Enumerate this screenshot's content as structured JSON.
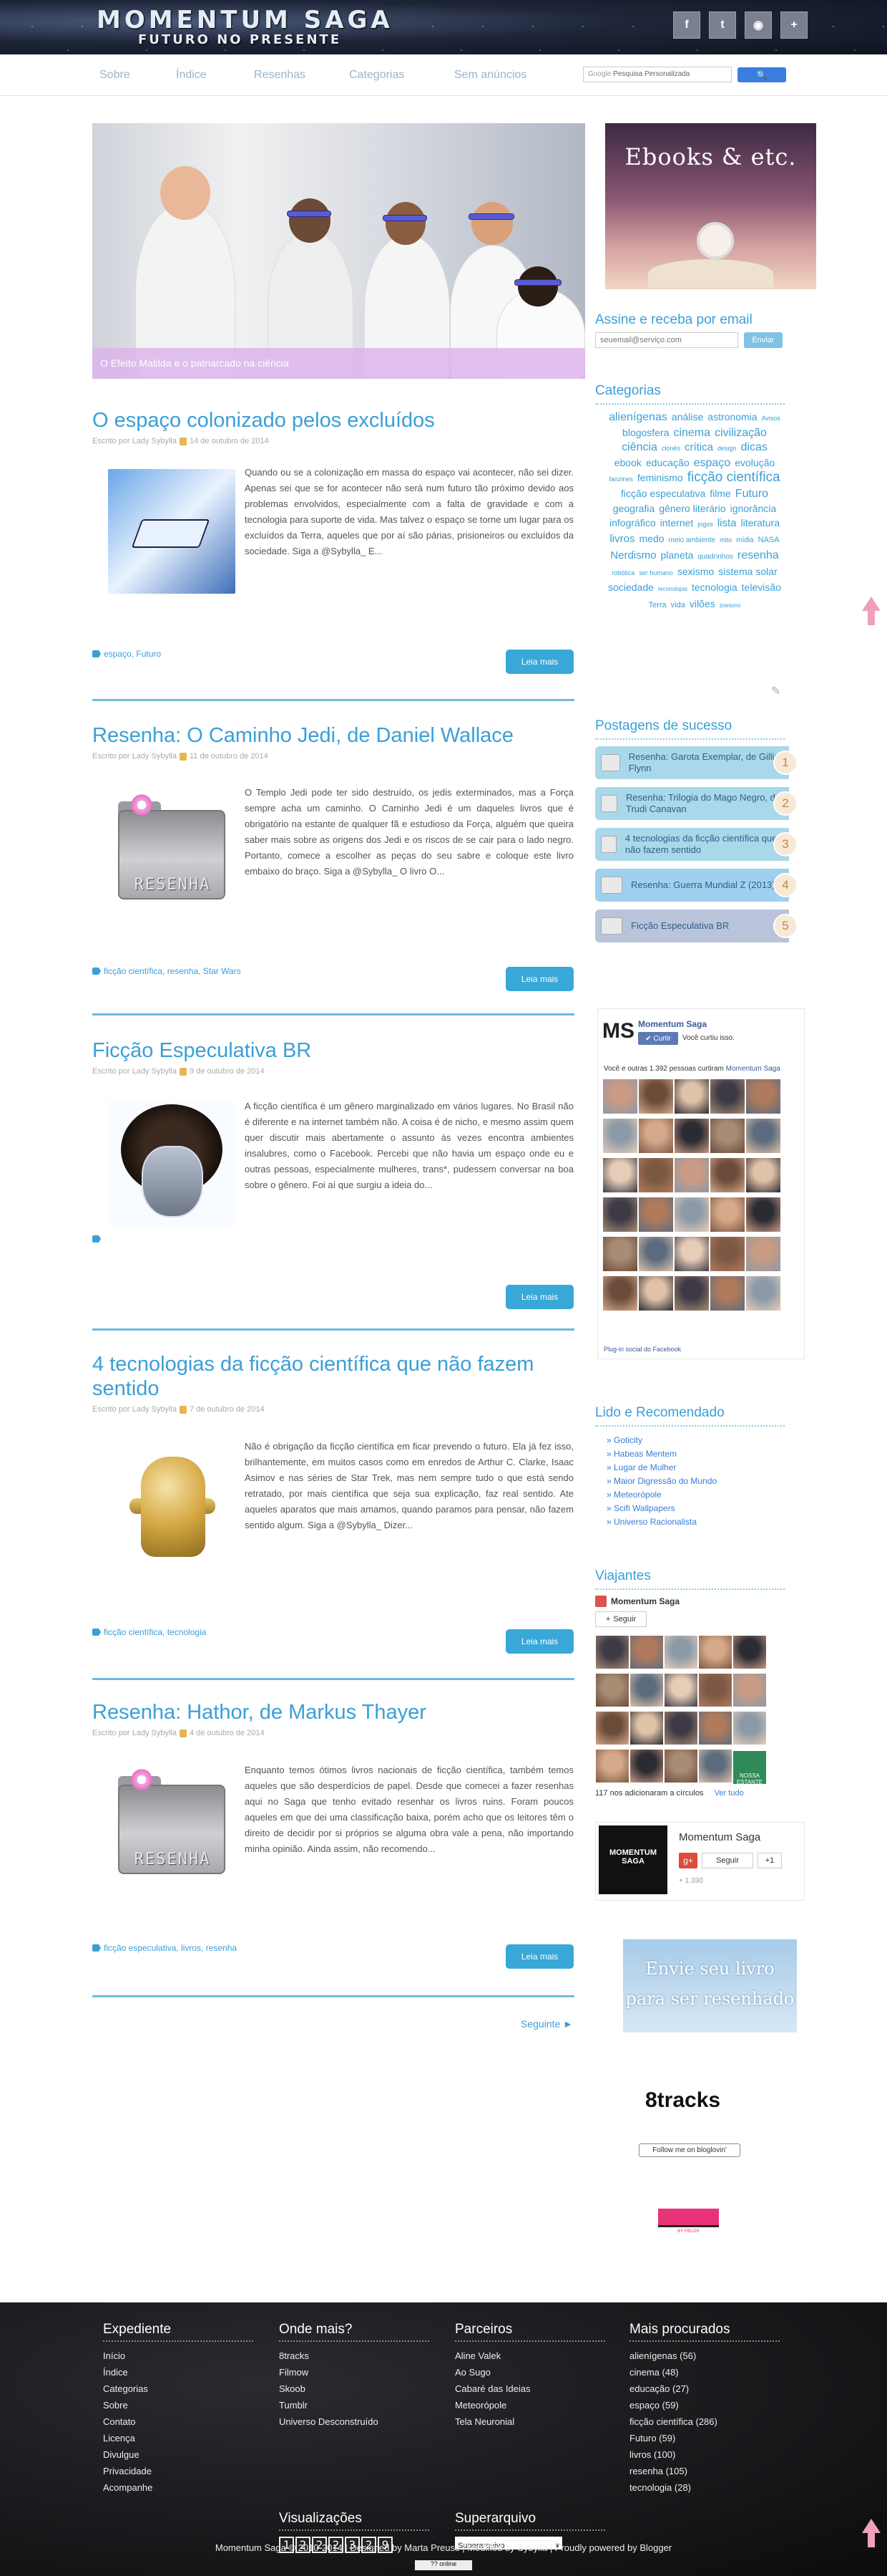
{
  "header": {
    "logo_line1": "MOMENTUM SAGA",
    "logo_line2": "FUTURO NO PRESENTE",
    "social": [
      "f",
      "t",
      "rss",
      "+"
    ]
  },
  "nav": {
    "items": [
      "Sobre",
      "Índice",
      "Resenhas",
      "Categorias",
      "Sem anúncios"
    ],
    "search_placeholder": "Pesquisa Personalizada",
    "search_prefix": "Google",
    "search_button": ""
  },
  "slider": {
    "caption": "O Efeito Matilda e o patriarcado na ciência"
  },
  "posts": [
    {
      "title": "O espaço colonizado pelos excluídos",
      "meta_prefix": "Escrito por Lady Sybylla",
      "date": "14 de outubro de 2014",
      "excerpt": "Quando ou se a colonização em massa do espaço vai acontecer, não sei dizer. Apenas sei que se for acontecer não será num futuro tão próximo devido aos problemas envolvidos, especialmente com a falta de gravidade e com a tecnologia para suporte de vida. Mas talvez o espaço se torne um lugar para os excluídos da Terra, aqueles que por aí são párias, prisioneiros ou excluídos da sociedade. Siga a @Sybylla_ E...",
      "tags": "espaço, Futuro",
      "read_more": "Leia mais"
    },
    {
      "title": "Resenha: O Caminho Jedi, de Daniel Wallace",
      "meta_prefix": "Escrito por Lady Sybylla",
      "date": "11 de outubro de 2014",
      "excerpt": "O Templo Jedi pode ter sido destruído, os jedis exterminados, mas a Força sempre acha um caminho. O Caminho Jedi é um daqueles livros que é obrigatório na estante de qualquer fã e estudioso da Força, alguém que queira saber mais sobre as origens dos Jedi e os riscos de se cair para o lado negro. Portanto, comece a escolher as peças do seu sabre e coloque este livro embaixo do braço. Siga a @Sybylla_ O livro O...",
      "tags": "ficção científica, resenha, Star Wars",
      "read_more": "Leia mais",
      "thumb_label": "RESENHA"
    },
    {
      "title": "Ficção Especulativa BR",
      "meta_prefix": "Escrito por Lady Sybylla",
      "date": "9 de outubro de 2014",
      "excerpt": "A ficção científica é um gênero marginalizado em vários lugares. No Brasil não é diferente e na internet também não. A coisa é de nicho, e mesmo assim quem quer discutir mais abertamente o assunto às vezes encontra ambientes insalubres, como o Facebook. Percebi que não havia um espaço onde eu e outras pessoas, especialmente mulheres, trans*, pudessem conversar na boa sobre o gênero. Foi aí que surgiu a ideia do...",
      "tags": "",
      "read_more": "Leia mais"
    },
    {
      "title": "4 tecnologias da ficção científica que não fazem sentido",
      "meta_prefix": "Escrito por Lady Sybylla",
      "date": "7 de outubro de 2014",
      "excerpt": "Não é obrigação da ficção científica em ficar prevendo o futuro. Ela já fez isso, brilhantemente, em muitos casos como em enredos de Arthur C. Clarke, Isaac Asimov e nas séries de Star Trek, mas nem sempre tudo o que está sendo retratado, por mais científica que seja sua explicação, faz real sentido. Ate aqueles aparatos que mais amamos, quando paramos para pensar, não fazem sentido algum. Siga a @Sybylla_ Dizer...",
      "tags": "ficção científica, tecnologia",
      "read_more": "Leia mais"
    },
    {
      "title": "Resenha: Hathor, de Markus Thayer",
      "meta_prefix": "Escrito por Lady Sybylla",
      "date": "4 de outubro de 2014",
      "excerpt": "Enquanto temos ótimos livros nacionais de ficção científica, também temos aqueles que são desperdícios de papel. Desde que comecei a fazer resenhas aqui no Saga que tenho evitado resenhar os livros ruins. Foram poucos aqueles em que dei uma classificação baixa, porém acho que os leitores têm o direito de decidir por si próprios se alguma obra vale a pena, não importando minha opinião. Ainda assim, não recomendo...",
      "tags": "ficção especulativa, livros, resenha",
      "read_more": "Leia mais",
      "thumb_label": "RESENHA"
    }
  ],
  "pagination": {
    "next": "Seguinte ►"
  },
  "sidebar": {
    "ebooks_title": "Ebooks & etc.",
    "email": {
      "title": "Assine e receba por email",
      "placeholder": "seuemail@serviço.com",
      "button": "Enviar"
    },
    "categories_title": "Categorias",
    "tag_cloud": [
      [
        "alienígenas",
        16
      ],
      [
        "análise",
        14
      ],
      [
        "astronomia",
        14
      ],
      [
        "Avisos",
        9
      ],
      [
        "blogosfera",
        14
      ],
      [
        "cinema",
        16
      ],
      [
        "civilização",
        16
      ],
      [
        "ciência",
        16
      ],
      [
        "clonês",
        9
      ],
      [
        "crítica",
        15
      ],
      [
        "design",
        9
      ],
      [
        "dicas",
        16
      ],
      [
        "ebook",
        14
      ],
      [
        "educação",
        14
      ],
      [
        "espaço",
        16
      ],
      [
        "evolução",
        14
      ],
      [
        "fanzines",
        9
      ],
      [
        "feminismo",
        14
      ],
      [
        "ficção científica",
        19
      ],
      [
        "ficção especulativa",
        14
      ],
      [
        "filme",
        14
      ],
      [
        "Futuro",
        16
      ],
      [
        "geografia",
        14
      ],
      [
        "gênero literário",
        14
      ],
      [
        "ignorância",
        14
      ],
      [
        "infográfico",
        14
      ],
      [
        "internet",
        14
      ],
      [
        "jogos",
        9
      ],
      [
        "lista",
        15
      ],
      [
        "literatura",
        14
      ],
      [
        "livros",
        15
      ],
      [
        "medo",
        14
      ],
      [
        "meio ambiente",
        10
      ],
      [
        "mito",
        9
      ],
      [
        "mídia",
        10
      ],
      [
        "NASA",
        11
      ],
      [
        "Nerdismo",
        15
      ],
      [
        "planeta",
        14
      ],
      [
        "quadrinhos",
        10
      ],
      [
        "resenha",
        16
      ],
      [
        "robótica",
        9
      ],
      [
        "ser humano",
        9
      ],
      [
        "sexismo",
        14
      ],
      [
        "sistema solar",
        14
      ],
      [
        "sociedade",
        14
      ],
      [
        "teconolopia",
        8
      ],
      [
        "tecnologia",
        14
      ],
      [
        "televisão",
        14
      ],
      [
        "Terra",
        11
      ],
      [
        "vida",
        11
      ],
      [
        "vilões",
        14
      ],
      [
        "zoeismo",
        8
      ]
    ],
    "popular_title": "Postagens de sucesso",
    "popular": [
      {
        "text": "Resenha: Garota Exemplar, de Gillian Flynn",
        "n": "1",
        "bg": "#a8d8ea"
      },
      {
        "text": "Resenha: Trilogia do Mago Negro, de Trudi Canavan",
        "n": "2",
        "bg": "#a8d8ea"
      },
      {
        "text": "4 tecnologias da ficção científica que não fazem sentido",
        "n": "3",
        "bg": "#a8d8ea"
      },
      {
        "text": "Resenha: Guerra Mundial Z (2013)",
        "n": "4",
        "bg": "#9fd0ee"
      },
      {
        "text": "Ficção Especulativa BR",
        "n": "5",
        "bg": "#b9c4da"
      }
    ],
    "facebook": {
      "page": "Momentum Saga",
      "like_btn": "Curtir",
      "like_text": "Você curtiu isso.",
      "others": "Você e outras 1.392 pessoas curtiram",
      "others_link": "Momentum Saga",
      "plugin": "Plug-in social do Facebook"
    },
    "recommended_title": "Lido e Recomendado",
    "recommended": [
      "Goticity",
      "Habeas Mentem",
      "Lugar de Mulher",
      "Maior Digressão do Mundo",
      "Meteorópole",
      "Scifi Wallpapers",
      "Universo Racionalista"
    ],
    "travelers_title": "Viajantes",
    "travelers": {
      "name": "Momentum Saga",
      "follow": "Seguir",
      "count": "117 nos adicionaram a círculos",
      "link": "Ver tudo",
      "nossa": "NOSSA ESTANTE"
    },
    "gplus": {
      "name": "Momentum Saga",
      "follow": "Seguir",
      "plus": "+1",
      "count": "+ 1.330",
      "logo_text": "MOMENTUM SAGA"
    },
    "envie": {
      "line1": "Envie seu livro",
      "line2": "para ser resenhado"
    },
    "8tracks": "8tracks",
    "bloglovin": "Follow me on bloglovin'",
    "fields": "BY FIELDS"
  },
  "footer": {
    "columns": [
      {
        "title": "Expediente",
        "items": [
          "Início",
          "Índice",
          "Categorias",
          "Sobre",
          "Contato",
          "Licença",
          "Divulgue",
          "Privacidade",
          "Acompanhe"
        ]
      },
      {
        "title": "Onde mais?",
        "items": [
          "8tracks",
          "Filmow",
          "Skoob",
          "Tumblr",
          "Universo Desconstruído"
        ]
      },
      {
        "title": "Parceiros",
        "items": [
          "Aline Valek",
          "Ao Sugo",
          "Cabaré das Ideias",
          "Meteorópole",
          "Tela Neuronial"
        ]
      },
      {
        "title": "Mais procurados",
        "items": [
          "alienígenas (56)",
          "cinema (48)",
          "educação (27)",
          "espaço (59)",
          "ficção científica (286)",
          "Futuro (59)",
          "livros (100)",
          "resenha (105)",
          "tecnologia (28)"
        ]
      }
    ],
    "visits_title": "Visualizações",
    "visits": "1222329",
    "archive_title": "Superarquivo",
    "archive_select": "Superarquivo",
    "copyright": "Momentum Saga © 2010-2014 | Designed by Marta Preuss | Modified by Sybylla | Proudly powered by Blogger",
    "online": "?? online"
  }
}
